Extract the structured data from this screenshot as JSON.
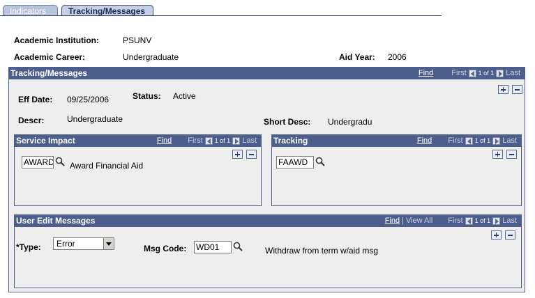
{
  "tabs": [
    {
      "label": "Indicators",
      "active": false
    },
    {
      "label": "Tracking/Messages",
      "active": true
    }
  ],
  "header": {
    "institution_label": "Academic Institution:",
    "institution_value": "PSUNV",
    "career_label": "Academic Career:",
    "career_value": "Undergraduate",
    "aid_year_label": "Aid Year:",
    "aid_year_value": "2006"
  },
  "tracking_messages": {
    "title": "Tracking/Messages",
    "nav": {
      "find": "Find",
      "first": "First",
      "count": "1 of 1",
      "last": "Last"
    },
    "eff_date_label": "Eff Date:",
    "eff_date_value": "09/25/2006",
    "status_label": "Status:",
    "status_value": "Active",
    "descr_label": "Descr:",
    "descr_value": "Undergraduate",
    "short_desc_label": "Short Desc:",
    "short_desc_value": "Undergradu"
  },
  "service_impact": {
    "title": "Service Impact",
    "nav": {
      "find": "Find",
      "first": "First",
      "count": "1 of 1",
      "last": "Last"
    },
    "code_value": "AWARD",
    "description": "Award Financial Aid"
  },
  "tracking": {
    "title": "Tracking",
    "nav": {
      "find": "Find",
      "first": "First",
      "count": "1 of 1",
      "last": "Last"
    },
    "code_value": "FAAWD"
  },
  "user_edit_messages": {
    "title": "User Edit Messages",
    "nav": {
      "find": "Find",
      "view_all": "View All",
      "first": "First",
      "count": "1 of 1",
      "last": "Last"
    },
    "type_label": "*Type:",
    "type_value": "Error",
    "msg_code_label": "Msg Code:",
    "msg_code_value": "WD01",
    "msg_description": "Withdraw from term w/aid msg"
  },
  "colors": {
    "panel_header": "#4c5f8c",
    "panel_body": "#eeeeee",
    "tab_inactive": "#b6c4de"
  }
}
